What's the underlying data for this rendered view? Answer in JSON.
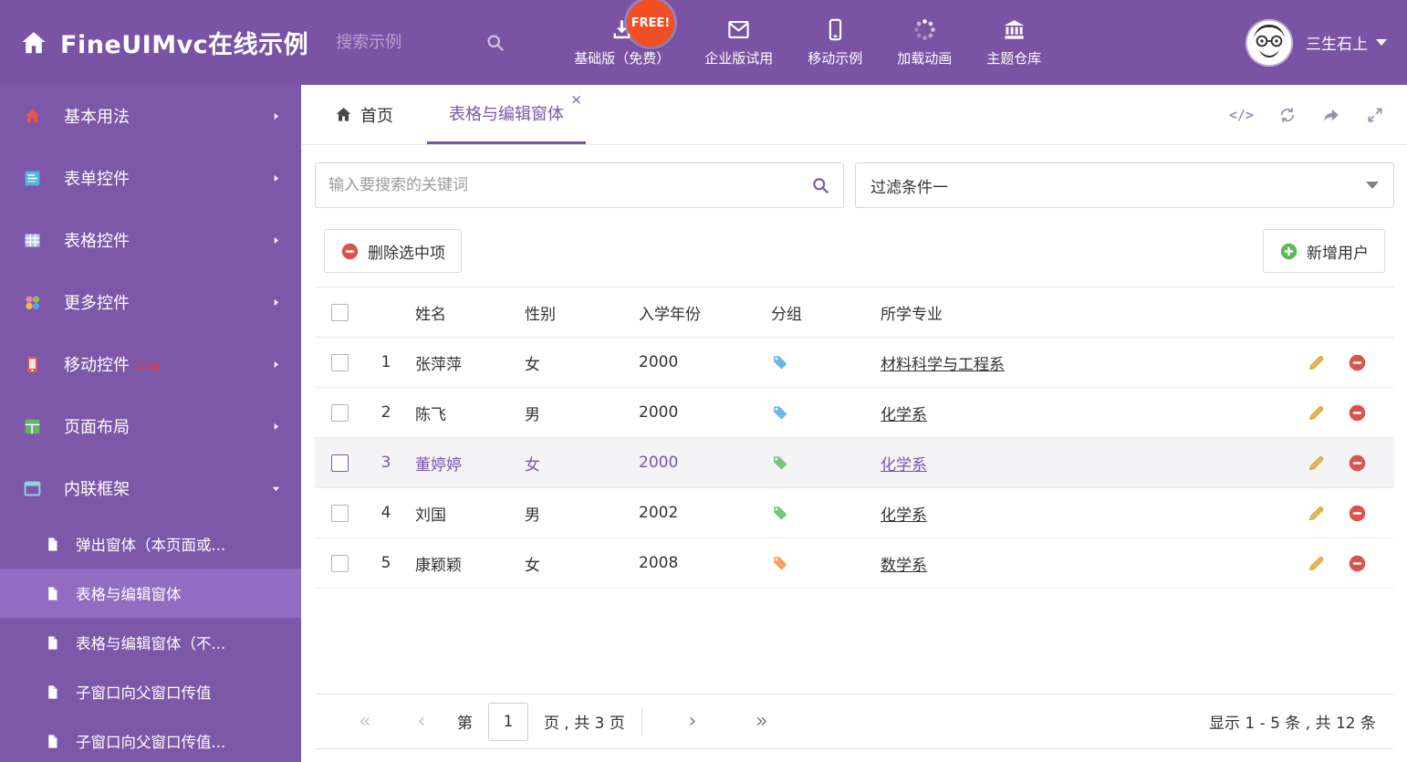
{
  "header": {
    "title": "FineUIMvc在线示例",
    "search_placeholder": "搜索示例",
    "free_badge": "FREE!",
    "nav_items": [
      {
        "label": "基础版（免费）",
        "icon": "download-icon"
      },
      {
        "label": "企业版试用",
        "icon": "envelope-icon"
      },
      {
        "label": "移动示例",
        "icon": "mobile-icon"
      },
      {
        "label": "加载动画",
        "icon": "spinner-icon"
      },
      {
        "label": "主题仓库",
        "icon": "bank-icon"
      }
    ],
    "username": "三生石上"
  },
  "sidebar": {
    "items": [
      {
        "label": "基本用法",
        "icon": "home-icon"
      },
      {
        "label": "表单控件",
        "icon": "form-icon"
      },
      {
        "label": "表格控件",
        "icon": "table-icon"
      },
      {
        "label": "更多控件",
        "icon": "widgets-icon"
      },
      {
        "label": "移动控件",
        "badge": "Corp.",
        "icon": "mobile-icon"
      },
      {
        "label": "页面布局",
        "icon": "layout-icon"
      },
      {
        "label": "内联框架",
        "icon": "frame-icon",
        "state": "expanded"
      }
    ],
    "subitems": [
      {
        "label": "弹出窗体（本页面或..."
      },
      {
        "label": "表格与编辑窗体",
        "active": true
      },
      {
        "label": "表格与编辑窗体（不..."
      },
      {
        "label": "子窗口向父窗口传值"
      },
      {
        "label": "子窗口向父窗口传值..."
      }
    ]
  },
  "tabs": [
    {
      "label": "首页"
    },
    {
      "label": "表格与编辑窗体",
      "active": true,
      "closable": true
    }
  ],
  "filters": {
    "search_placeholder": "输入要搜索的关键词",
    "filter_value": "过滤条件一"
  },
  "toolbar": {
    "delete_button": "删除选中项",
    "add_button": "新增用户"
  },
  "table": {
    "columns": [
      "姓名",
      "性别",
      "入学年份",
      "分组",
      "所学专业"
    ],
    "rows": [
      {
        "num": "1",
        "name": "张萍萍",
        "gender": "女",
        "year": "2000",
        "tag_color": "#6ab7e6",
        "major": "材料科学与工程系"
      },
      {
        "num": "2",
        "name": "陈飞",
        "gender": "男",
        "year": "2000",
        "tag_color": "#6ab7e6",
        "major": "化学系"
      },
      {
        "num": "3",
        "name": "董婷婷",
        "gender": "女",
        "year": "2000",
        "tag_color": "#79c47d",
        "major": "化学系",
        "selected": true
      },
      {
        "num": "4",
        "name": "刘国",
        "gender": "男",
        "year": "2002",
        "tag_color": "#79c47d",
        "major": "化学系"
      },
      {
        "num": "5",
        "name": "康颖颖",
        "gender": "女",
        "year": "2008",
        "tag_color": "#f0a45c",
        "major": "数学系"
      }
    ]
  },
  "pagination": {
    "page_prefix": "第",
    "current_page": "1",
    "page_suffix": "页 , 共 3 页",
    "summary": "显示 1 - 5 条 , 共 12 条"
  },
  "colors": {
    "primary": "#7b56a6",
    "header_bg": "#7a53a4",
    "sidebar_bg": "#7d57a8",
    "sidebar_active_bg": "#916cc0",
    "free_badge_bg": "#f04e23",
    "danger": "#d9534f",
    "success": "#5cb85c",
    "pencil": "#e8b64c"
  }
}
